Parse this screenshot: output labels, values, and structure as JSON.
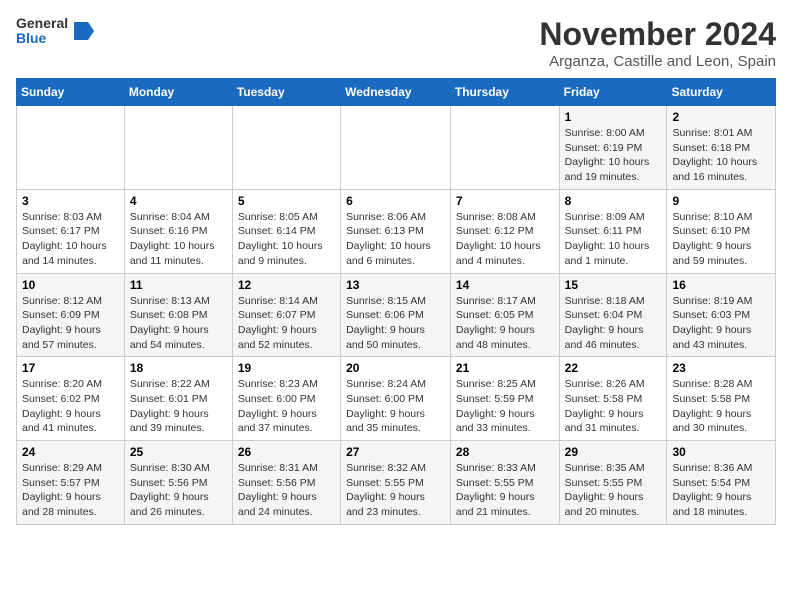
{
  "logo": {
    "general": "General",
    "blue": "Blue"
  },
  "title": "November 2024",
  "subtitle": "Arganza, Castille and Leon, Spain",
  "headers": [
    "Sunday",
    "Monday",
    "Tuesday",
    "Wednesday",
    "Thursday",
    "Friday",
    "Saturday"
  ],
  "rows": [
    [
      {
        "day": "",
        "content": ""
      },
      {
        "day": "",
        "content": ""
      },
      {
        "day": "",
        "content": ""
      },
      {
        "day": "",
        "content": ""
      },
      {
        "day": "",
        "content": ""
      },
      {
        "day": "1",
        "content": "Sunrise: 8:00 AM\nSunset: 6:19 PM\nDaylight: 10 hours and 19 minutes."
      },
      {
        "day": "2",
        "content": "Sunrise: 8:01 AM\nSunset: 6:18 PM\nDaylight: 10 hours and 16 minutes."
      }
    ],
    [
      {
        "day": "3",
        "content": "Sunrise: 8:03 AM\nSunset: 6:17 PM\nDaylight: 10 hours and 14 minutes."
      },
      {
        "day": "4",
        "content": "Sunrise: 8:04 AM\nSunset: 6:16 PM\nDaylight: 10 hours and 11 minutes."
      },
      {
        "day": "5",
        "content": "Sunrise: 8:05 AM\nSunset: 6:14 PM\nDaylight: 10 hours and 9 minutes."
      },
      {
        "day": "6",
        "content": "Sunrise: 8:06 AM\nSunset: 6:13 PM\nDaylight: 10 hours and 6 minutes."
      },
      {
        "day": "7",
        "content": "Sunrise: 8:08 AM\nSunset: 6:12 PM\nDaylight: 10 hours and 4 minutes."
      },
      {
        "day": "8",
        "content": "Sunrise: 8:09 AM\nSunset: 6:11 PM\nDaylight: 10 hours and 1 minute."
      },
      {
        "day": "9",
        "content": "Sunrise: 8:10 AM\nSunset: 6:10 PM\nDaylight: 9 hours and 59 minutes."
      }
    ],
    [
      {
        "day": "10",
        "content": "Sunrise: 8:12 AM\nSunset: 6:09 PM\nDaylight: 9 hours and 57 minutes."
      },
      {
        "day": "11",
        "content": "Sunrise: 8:13 AM\nSunset: 6:08 PM\nDaylight: 9 hours and 54 minutes."
      },
      {
        "day": "12",
        "content": "Sunrise: 8:14 AM\nSunset: 6:07 PM\nDaylight: 9 hours and 52 minutes."
      },
      {
        "day": "13",
        "content": "Sunrise: 8:15 AM\nSunset: 6:06 PM\nDaylight: 9 hours and 50 minutes."
      },
      {
        "day": "14",
        "content": "Sunrise: 8:17 AM\nSunset: 6:05 PM\nDaylight: 9 hours and 48 minutes."
      },
      {
        "day": "15",
        "content": "Sunrise: 8:18 AM\nSunset: 6:04 PM\nDaylight: 9 hours and 46 minutes."
      },
      {
        "day": "16",
        "content": "Sunrise: 8:19 AM\nSunset: 6:03 PM\nDaylight: 9 hours and 43 minutes."
      }
    ],
    [
      {
        "day": "17",
        "content": "Sunrise: 8:20 AM\nSunset: 6:02 PM\nDaylight: 9 hours and 41 minutes."
      },
      {
        "day": "18",
        "content": "Sunrise: 8:22 AM\nSunset: 6:01 PM\nDaylight: 9 hours and 39 minutes."
      },
      {
        "day": "19",
        "content": "Sunrise: 8:23 AM\nSunset: 6:00 PM\nDaylight: 9 hours and 37 minutes."
      },
      {
        "day": "20",
        "content": "Sunrise: 8:24 AM\nSunset: 6:00 PM\nDaylight: 9 hours and 35 minutes."
      },
      {
        "day": "21",
        "content": "Sunrise: 8:25 AM\nSunset: 5:59 PM\nDaylight: 9 hours and 33 minutes."
      },
      {
        "day": "22",
        "content": "Sunrise: 8:26 AM\nSunset: 5:58 PM\nDaylight: 9 hours and 31 minutes."
      },
      {
        "day": "23",
        "content": "Sunrise: 8:28 AM\nSunset: 5:58 PM\nDaylight: 9 hours and 30 minutes."
      }
    ],
    [
      {
        "day": "24",
        "content": "Sunrise: 8:29 AM\nSunset: 5:57 PM\nDaylight: 9 hours and 28 minutes."
      },
      {
        "day": "25",
        "content": "Sunrise: 8:30 AM\nSunset: 5:56 PM\nDaylight: 9 hours and 26 minutes."
      },
      {
        "day": "26",
        "content": "Sunrise: 8:31 AM\nSunset: 5:56 PM\nDaylight: 9 hours and 24 minutes."
      },
      {
        "day": "27",
        "content": "Sunrise: 8:32 AM\nSunset: 5:55 PM\nDaylight: 9 hours and 23 minutes."
      },
      {
        "day": "28",
        "content": "Sunrise: 8:33 AM\nSunset: 5:55 PM\nDaylight: 9 hours and 21 minutes."
      },
      {
        "day": "29",
        "content": "Sunrise: 8:35 AM\nSunset: 5:55 PM\nDaylight: 9 hours and 20 minutes."
      },
      {
        "day": "30",
        "content": "Sunrise: 8:36 AM\nSunset: 5:54 PM\nDaylight: 9 hours and 18 minutes."
      }
    ]
  ]
}
